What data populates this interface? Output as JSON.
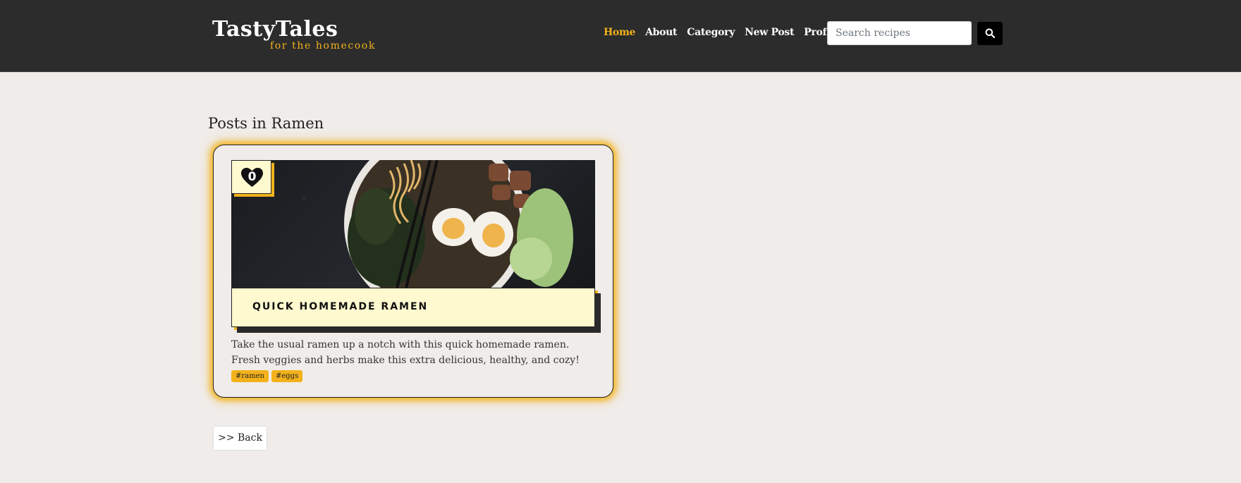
{
  "brand": {
    "title": "TastyTales",
    "tagline": "for the homecook"
  },
  "nav": {
    "items": [
      {
        "label": "Home",
        "active": true
      },
      {
        "label": "About",
        "active": false
      },
      {
        "label": "Category",
        "active": false
      },
      {
        "label": "New Post",
        "active": false
      },
      {
        "label": "Profile",
        "active": false,
        "dropdown": true
      }
    ],
    "search": {
      "placeholder": "Search recipes",
      "value": ""
    },
    "search_icon": "search-icon"
  },
  "main": {
    "heading": "Posts in Ramen",
    "posts": [
      {
        "likes": "0",
        "like_icon": "heart-icon",
        "title": "QUICK HOMEMADE RAMEN",
        "description": "Take the usual ramen up a notch with this quick homemade ramen. Fresh veggies and herbs make this extra delicious, healthy, and cozy!",
        "tags": [
          "#ramen",
          "#eggs"
        ],
        "image": "ramen bowl with eggs, noodles, meat, lettuce"
      }
    ],
    "back_label": ">> Back"
  },
  "colors": {
    "navbar_bg": "#2c2c2c",
    "accent": "#f3b21b",
    "page_bg": "#f0ece9",
    "title_box_bg": "#fff9cf"
  }
}
